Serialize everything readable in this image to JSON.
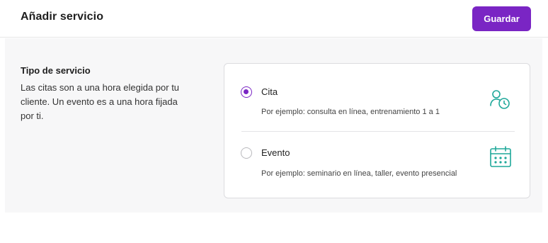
{
  "header": {
    "title": "Añadir servicio",
    "save_label": "Guardar"
  },
  "service_type": {
    "title": "Tipo de servicio",
    "description": "Las citas son a una hora elegida por tu cliente. Un evento es a una hora fijada por ti."
  },
  "options": [
    {
      "label": "Cita",
      "example": "Por ejemplo: consulta en línea, entrenamiento 1 a 1",
      "selected": true,
      "icon": "person-clock-icon"
    },
    {
      "label": "Evento",
      "example": "Por ejemplo: seminario en línea, taller, evento presencial",
      "selected": false,
      "icon": "calendar-icon"
    }
  ],
  "colors": {
    "accent": "#7a25c4",
    "icon_teal": "#1fa89a"
  }
}
